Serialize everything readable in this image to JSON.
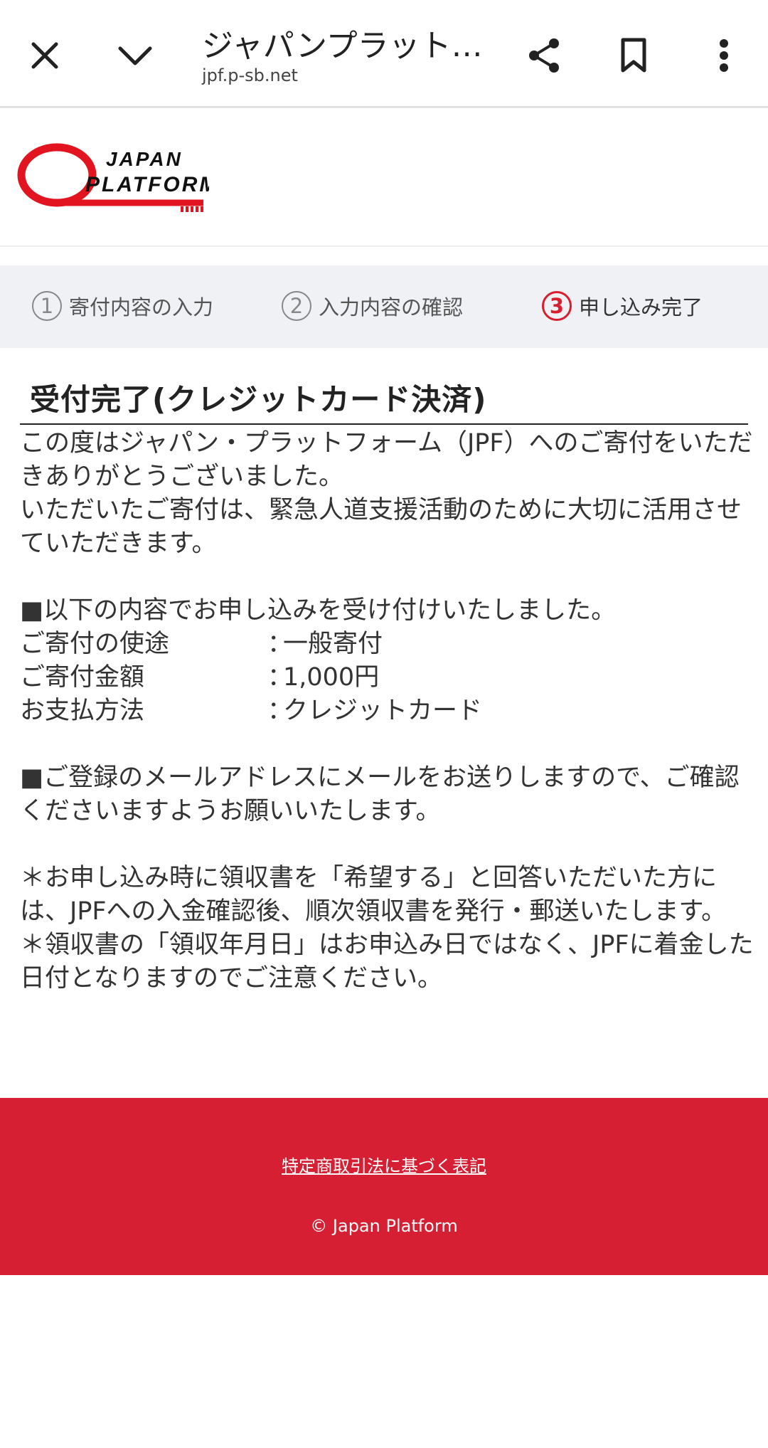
{
  "browser": {
    "title": "ジャパンプラット…",
    "url": "jpf.p-sb.net",
    "icons": [
      "close-icon",
      "chevron-down-icon",
      "share-icon",
      "bookmark-icon",
      "more-vert-icon"
    ]
  },
  "logo": {
    "line1": "JAPAN",
    "line2": "PLATFORM"
  },
  "steps": [
    {
      "num": "1",
      "label": "寄付内容の入力"
    },
    {
      "num": "2",
      "label": "入力内容の確認"
    },
    {
      "num": "3",
      "label": "申し込み完了"
    }
  ],
  "heading": "受付完了(クレジットカード決済)",
  "body": {
    "intro1": "この度はジャパン・プラットフォーム（JPF）へのご寄付をいただきありがとうございました。",
    "intro2": "いただいたご寄付は、緊急人道支援活動のために大切に活用させていただきます。",
    "accepted": "■以下の内容でお申し込みを受け付けいたしました。",
    "details": [
      {
        "label": "ご寄付の使途",
        "value": "一般寄付"
      },
      {
        "label": "ご寄付金額",
        "value": "1,000円"
      },
      {
        "label": "お支払方法",
        "value": "クレジットカード"
      }
    ],
    "separator": "：",
    "email_notice": "■ご登録のメールアドレスにメールをお送りしますので、ご確認くださいますようお願いいたします。",
    "note1": "＊お申し込み時に領収書を「希望する」と回答いただいた方には、JPFへの入金確認後、順次領収書を発行・郵送いたします。",
    "note2": "＊領収書の「領収年月日」はお申込み日ではなく、JPFに着金した日付となりますのでご注意ください。"
  },
  "footer": {
    "link": "特定商取引法に基づく表記",
    "copyright": "© Japan Platform"
  },
  "colors": {
    "brand_red": "#d71f34",
    "step_bg": "#f0f1f4"
  }
}
